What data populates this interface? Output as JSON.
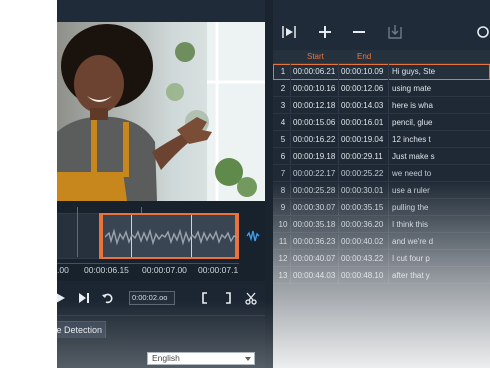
{
  "timeline": {
    "labels": [
      ".00",
      "00:00:06.15",
      "00:00:07.00",
      "00:00:07.1"
    ],
    "detect_icon": "audio-wave-icon"
  },
  "transport": {
    "timecode": "0:00:02.oo",
    "play_icon": "play-icon",
    "next_icon": "next-frame-icon",
    "repeat_icon": "repeat-icon",
    "mark_in_icon": "mark-in-icon",
    "mark_out_icon": "mark-out-icon",
    "cut_icon": "scissors-icon"
  },
  "bottom": {
    "tab_label": "e Detection",
    "language": "English"
  },
  "toolbar": {
    "icons": [
      "play-subtitle-icon",
      "add-icon",
      "remove-icon",
      "import-icon",
      "more-icon"
    ]
  },
  "list": {
    "columns": {
      "start": "Start",
      "end": "End"
    },
    "rows": [
      {
        "num": "1",
        "start": "00:00:06.21",
        "end": "00:00:10.09",
        "text": "Hi guys, Ste",
        "selected": true
      },
      {
        "num": "2",
        "start": "00:00:10.16",
        "end": "00:00:12.06",
        "text": "using mate"
      },
      {
        "num": "3",
        "start": "00:00:12.18",
        "end": "00:00:14.03",
        "text": "here is wha"
      },
      {
        "num": "4",
        "start": "00:00:15.06",
        "end": "00:00:16.01",
        "text": "pencil, glue"
      },
      {
        "num": "5",
        "start": "00:00:16.22",
        "end": "00:00:19.04",
        "text": "12 inches t"
      },
      {
        "num": "6",
        "start": "00:00:19.18",
        "end": "00:00:29.11",
        "text": "Just make s"
      },
      {
        "num": "7",
        "start": "00:00:22.17",
        "end": "00:00:25.22",
        "text": "we need to"
      },
      {
        "num": "8",
        "start": "00:00:25.28",
        "end": "00:00:30.01",
        "text": "use a ruler"
      },
      {
        "num": "9",
        "start": "00:00:30.07",
        "end": "00:00:35.15",
        "text": "pulling the"
      },
      {
        "num": "10",
        "start": "00:00:35.18",
        "end": "00:00:36.20",
        "text": "I think this"
      },
      {
        "num": "11",
        "start": "00:00:36.23",
        "end": "00:00:40.02",
        "text": "and we're d"
      },
      {
        "num": "12",
        "start": "00:00:40.07",
        "end": "00:00:43.22",
        "text": "I cut four p"
      },
      {
        "num": "13",
        "start": "00:00:44.03",
        "end": "00:00:48.10",
        "text": "after that y"
      }
    ]
  },
  "colors": {
    "accent": "#e8733c",
    "panel": "#1f2b38",
    "text": "#cfd6dc"
  }
}
